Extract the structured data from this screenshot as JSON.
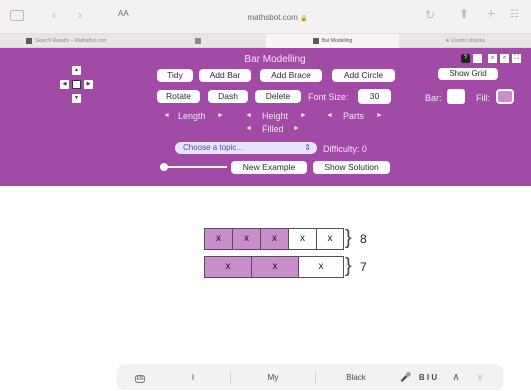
{
  "browser": {
    "text_size_label": "AA",
    "url": "mathsbot.com",
    "tabs": [
      {
        "label": "Search Results – MathsBot.com"
      },
      {
        "label": ""
      },
      {
        "label": "Bar Modelling"
      },
      {
        "label": "Úvodní stránka"
      }
    ]
  },
  "app": {
    "title": "Bar Modelling",
    "buttons": {
      "tidy": "Tidy",
      "add_bar": "Add Bar",
      "add_brace": "Add Brace",
      "add_circle": "Add Circle",
      "rotate": "Rotate",
      "dash": "Dash",
      "delete": "Delete",
      "show_grid": "Show Grid",
      "new_example": "New Example",
      "show_solution": "Show Solution"
    },
    "font_size_label": "Font Size:",
    "font_size_value": "30",
    "bar_label": "Bar:",
    "fill_label": "Fill:",
    "length_label": "Length",
    "height_label": "Height",
    "parts_label": "Parts",
    "filled_label": "Filled",
    "topic_placeholder": "Choose a topic...",
    "difficulty_label": "Difficulty: 0",
    "fill_color": "#c98ecb",
    "bar_color": "#ffffff"
  },
  "canvas": {
    "bars": [
      {
        "cells": [
          {
            "text": "x",
            "filled": true
          },
          {
            "text": "x",
            "filled": true
          },
          {
            "text": "x",
            "filled": true
          },
          {
            "text": "x",
            "filled": false
          },
          {
            "text": "x",
            "filled": false
          }
        ],
        "brace_value": "8"
      },
      {
        "cells": [
          {
            "text": "x",
            "filled": true
          },
          {
            "text": "x",
            "filled": true
          },
          {
            "text": "x",
            "filled": false
          }
        ],
        "brace_value": "7"
      }
    ]
  },
  "keyboard_bar": {
    "lang": "EN",
    "suggestions": [
      "I",
      "My",
      "Black"
    ],
    "format": "B I U"
  }
}
